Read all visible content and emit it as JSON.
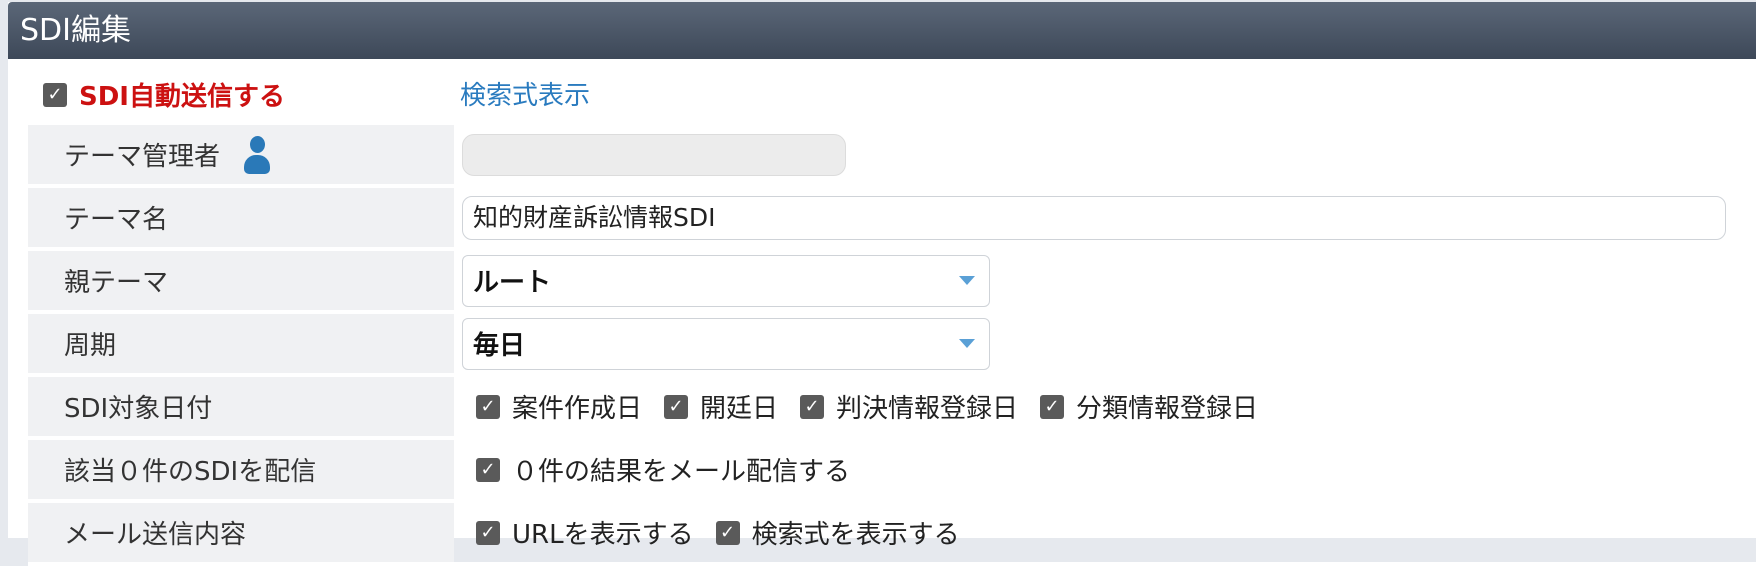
{
  "window": {
    "title": "SDI編集"
  },
  "auto_send": {
    "label": "SDI自動送信する",
    "checked": true
  },
  "search_link": "検索式表示",
  "fields": {
    "theme_admin": {
      "label": "テーマ管理者",
      "value": ""
    },
    "theme_name": {
      "label": "テーマ名",
      "value": "知的財産訴訟情報SDI"
    },
    "parent_theme": {
      "label": "親テーマ",
      "value": "ルート"
    },
    "cycle": {
      "label": "周期",
      "value": "毎日"
    },
    "target_dates": {
      "label": "SDI対象日付",
      "options": [
        {
          "label": "案件作成日",
          "checked": true
        },
        {
          "label": "開廷日",
          "checked": true
        },
        {
          "label": "判決情報登録日",
          "checked": true
        },
        {
          "label": "分類情報登録日",
          "checked": true
        }
      ]
    },
    "zero_results": {
      "label": "該当０件のSDIを配信",
      "option": {
        "label": "０件の結果をメール配信する",
        "checked": true
      }
    },
    "mail_content": {
      "label": "メール送信内容",
      "options": [
        {
          "label": "URLを表示する",
          "checked": true
        },
        {
          "label": "検索式を表示する",
          "checked": true
        }
      ]
    }
  },
  "icons": {
    "check": "✓",
    "user": "user-icon",
    "caret": "chevron-down-icon"
  },
  "colors": {
    "title_bg": "#4a5566",
    "auto_send_text": "#cc1111",
    "link": "#2a7bbf",
    "icon_blue": "#2a79b8"
  }
}
